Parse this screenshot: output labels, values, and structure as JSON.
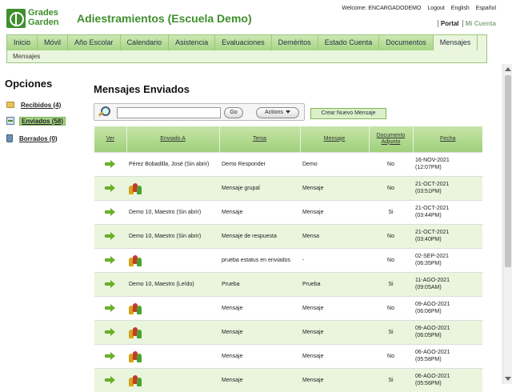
{
  "header": {
    "logo_line1": "Grades",
    "logo_line2": "Garden",
    "app_title": "Adiestramientos (Escuela Demo)",
    "welcome": "Welcome: ENCARGADODEMO",
    "logout": "Logout",
    "lang_english": "English",
    "lang_spanish": "Español",
    "portal": "Portal",
    "mi_cuenta": "Mi Cuenta"
  },
  "nav": {
    "tabs": [
      "Inicio",
      "Móvil",
      "Año Escolar",
      "Calendario",
      "Asistencia",
      "Evaluaciones",
      "Deméritos",
      "Estado Cuenta",
      "Documentos",
      "Mensajes"
    ],
    "active": "Mensajes",
    "sub": "Mensajes"
  },
  "sidebar": {
    "title": "Opciones",
    "items": [
      {
        "label": "Recibidos (4)",
        "icon": "folder-icon"
      },
      {
        "label": "Enviados (58)",
        "icon": "sent-icon"
      },
      {
        "label": "Borrados (0)",
        "icon": "trash-icon"
      }
    ]
  },
  "main": {
    "title": "Mensajes Enviados",
    "search": {
      "value": "",
      "placeholder": ""
    },
    "go_label": "Go",
    "actions_label": "Actions",
    "new_label": "Crear Nuevo Mensaje"
  },
  "table": {
    "headers": [
      "Ver",
      "Enviado A",
      "Tema",
      "Mensaje",
      "Documento Adjunto",
      "Fecha"
    ],
    "rows": [
      {
        "recipient": "Pérez Bobadilla, José (Sin abrir)",
        "group": false,
        "tema": "Demo Responder",
        "mensaje": "Demo",
        "adjunto": "No",
        "fecha": "16-NOV-2021",
        "hora": "(12:07PM)"
      },
      {
        "recipient": "",
        "group": true,
        "tema": "Mensaje grupal",
        "mensaje": "Mensaje",
        "adjunto": "No",
        "fecha": "21-OCT-2021",
        "hora": "(03:51PM)"
      },
      {
        "recipient": "Demo 10, Maestro (Sin abrir)",
        "group": false,
        "tema": "Mensaje",
        "mensaje": "Mensaje",
        "adjunto": "Si",
        "fecha": "21-OCT-2021",
        "hora": "(03:44PM)"
      },
      {
        "recipient": "Demo 10, Maestro (Sin abrir)",
        "group": false,
        "tema": "Mensaje de respuesta",
        "mensaje": "Mensa",
        "adjunto": "No",
        "fecha": "21-OCT-2021",
        "hora": "(03:40PM)"
      },
      {
        "recipient": "",
        "group": true,
        "tema": "prueba estatus en enviados",
        "mensaje": "-",
        "adjunto": "No",
        "fecha": "02-SEP-2021",
        "hora": "(06:35PM)"
      },
      {
        "recipient": "Demo 10, Maestro (Leído)",
        "group": false,
        "tema": "Prueba",
        "mensaje": "Prueba",
        "adjunto": "Si",
        "fecha": "11-AGO-2021",
        "hora": "(09:05AM)"
      },
      {
        "recipient": "",
        "group": true,
        "tema": "Mensaje",
        "mensaje": "Mensaje",
        "adjunto": "No",
        "fecha": "09-AGO-2021",
        "hora": "(06:06PM)"
      },
      {
        "recipient": "",
        "group": true,
        "tema": "Mensaje",
        "mensaje": "Mensaje",
        "adjunto": "Si",
        "fecha": "09-AGO-2021",
        "hora": "(06:05PM)"
      },
      {
        "recipient": "",
        "group": true,
        "tema": "Mensaje",
        "mensaje": "Mensaje",
        "adjunto": "No",
        "fecha": "06-AGO-2021",
        "hora": "(05:58PM)"
      },
      {
        "recipient": "",
        "group": true,
        "tema": "Mensaje",
        "mensaje": "Mensaje",
        "adjunto": "Si",
        "fecha": "06-AGO-2021",
        "hora": "(05:56PM)"
      }
    ]
  }
}
